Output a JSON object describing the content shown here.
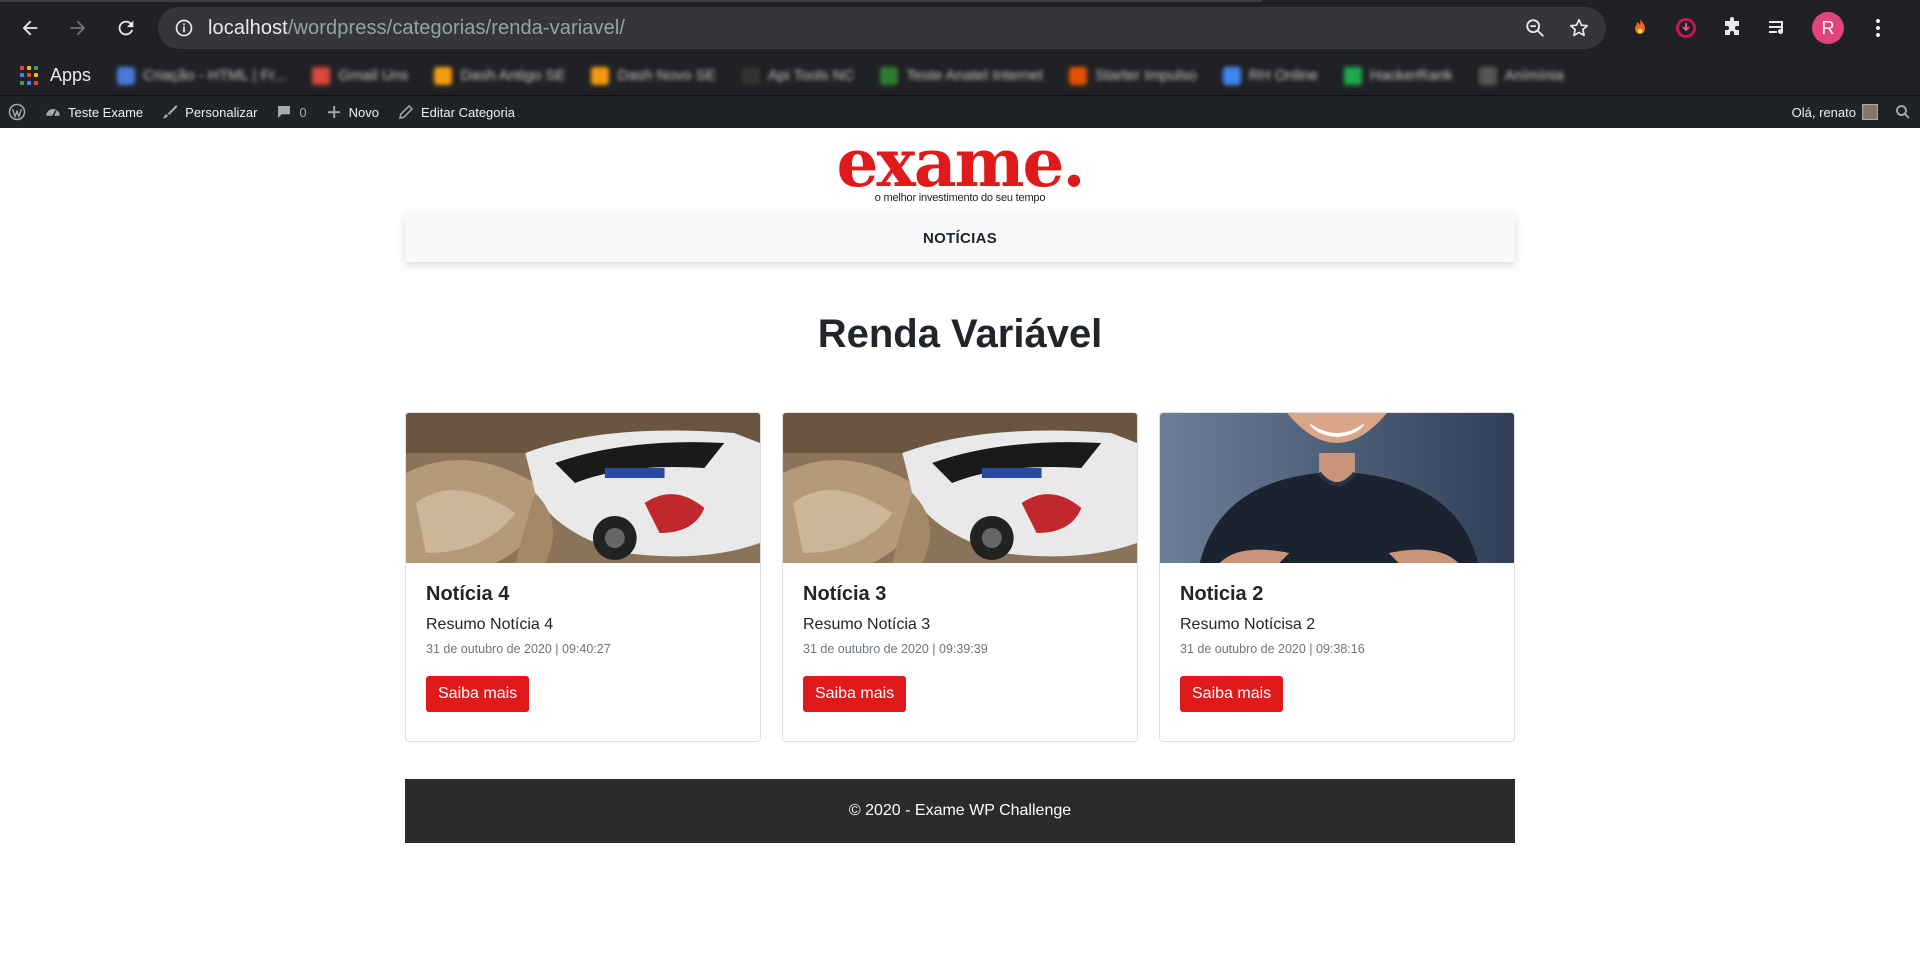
{
  "browser": {
    "url_host": "localhost",
    "url_path": "/wordpress/categorias/renda-variavel/",
    "profile_initial": "R",
    "bookmarks": {
      "apps_label": "Apps",
      "items": [
        {
          "label": "Criação - HTML | Fr...",
          "color": "#4a7bd8"
        },
        {
          "label": "Gmail Uns",
          "color": "#d94b3a"
        },
        {
          "label": "Dash Antigo SE",
          "color": "#f39c12"
        },
        {
          "label": "Dash Novo SE",
          "color": "#f39c12"
        },
        {
          "label": "Api Tools NC",
          "color": "#333333"
        },
        {
          "label": "Teste Anatel Internet",
          "color": "#2e7d32"
        },
        {
          "label": "Starter Impulso",
          "color": "#e65100"
        },
        {
          "label": "RH Online",
          "color": "#4285f4"
        },
        {
          "label": "HackerRank",
          "color": "#1ba94c"
        },
        {
          "label": "Anímínia",
          "color": "#555555"
        }
      ]
    }
  },
  "adminbar": {
    "site_name": "Teste Exame",
    "customize": "Personalizar",
    "comments_count": "0",
    "new": "Novo",
    "edit_category": "Editar Categoria",
    "greeting": "Olá, renato"
  },
  "site": {
    "logo": "exame.",
    "tagline": "o melhor investimento do seu tempo",
    "nav_item": "NOTÍCIAS",
    "category_title": "Renda Variável",
    "footer": "© 2020 - Exame WP Challenge"
  },
  "posts": [
    {
      "title": "Notícia 4",
      "summary": "Resumo Notícia 4",
      "date": "31 de outubro de 2020 | 09:40:27",
      "button": "Saiba mais",
      "image": "rally-car"
    },
    {
      "title": "Notícia 3",
      "summary": "Resumo Notícia 3",
      "date": "31 de outubro de 2020 | 09:39:39",
      "button": "Saiba mais",
      "image": "rally-car"
    },
    {
      "title": "Noticia 2",
      "summary": "Resumo Notícisa 2",
      "date": "31 de outubro de 2020 | 09:38:16",
      "button": "Saiba mais",
      "image": "person-portrait"
    }
  ],
  "colors": {
    "brand_red": "#e0191b",
    "footer_bg": "#2b2b2b",
    "adminbar_bg": "#1d2327"
  }
}
